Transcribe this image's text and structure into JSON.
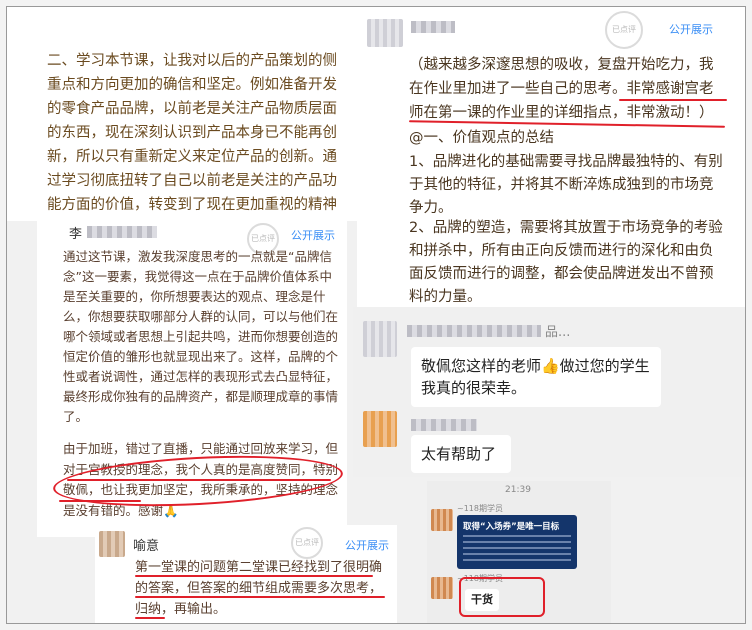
{
  "left_top": {
    "text": "二、学习本节课，让我对以后的产品策划的侧重点和方向更加的确信和坚定。例如准备开发的零食产品品牌，以前老是关注产品物质层面的东西，现在深刻认识到产品本身已不能再创新，所以只有重新定义来定位产品的创新。通过学习彻底扭转了自己以前老是关注的产品功能方面的价值，转变到了现在更加重视的精神层面的价值。"
  },
  "right_top": {
    "public_label": "公开展示",
    "line1": "（越来越多深邃思想的吸收，复盘开始吃力，我在作业里加进了一些自己的思考。",
    "line1_red": "非常感谢宫老师在第一课的作业里的详细指点，非常激动！）",
    "heading": "@一、价值观点的总结",
    "p1": "1、品牌进化的基础需要寻找品牌最独特的、有别于其他的特征，并将其不断淬炼成独到的市场竞争力。",
    "p2": "2、品牌的塑造，需要将其放置于市场竞争的考验和拼杀中，所有由正向反馈而进行的深化和由负面反馈而进行的调整，都会使品牌迸发出不曾预料的力量。"
  },
  "left_mid": {
    "name": "李",
    "public_label": "公开展示",
    "p1": "通过这节课，激发我深度思考的一点就是“品牌信念”这一要素，我觉得这一点在于品牌价值体系中是至关重要的，你所想要表达的观点、理念是什么，你想要获取哪部分人群的认同，可以与他们在哪个领域或者思想上引起共鸣，进而你想要创造的恒定价值的雏形也就显现出来了。这样，品牌的个性或者说调性，通过怎样的表现形式去凸显特征，最终形成你独有的品牌资产，都是顺理成章的事情了。",
    "p2a": "由于加班，错过了直播，只能通过回放来学习，",
    "p2b": "但对于宫教授的理念，我个人真的是高度赞同，特别敬佩，",
    "p2c": "也让我更加坚定，我所秉承的，坚持的理念是没有错的。感谢🙏"
  },
  "left_bottom": {
    "name": "喻意",
    "public_label": "公开展示",
    "text_red": "第一堂课的问题第二堂课已经找到了很明确的答案，但答案的细节组成需要多次思考，归纳，再输出。"
  },
  "chat": {
    "name1": "品...",
    "msg1": "敬佩您这样的老师👍做过您的学生我真的很荣幸。",
    "msg2": "太有帮助了"
  },
  "phone": {
    "time": "21:39",
    "sender1": "~118期学员",
    "banner": "取得“入场券”是唯一目标",
    "sender2": "~118期学员",
    "msg": "干货"
  },
  "stamp_label": "已点评",
  "colors": {
    "red": "#e0202a",
    "link_blue": "#3a8ef5",
    "banner_navy": "#14356b"
  }
}
